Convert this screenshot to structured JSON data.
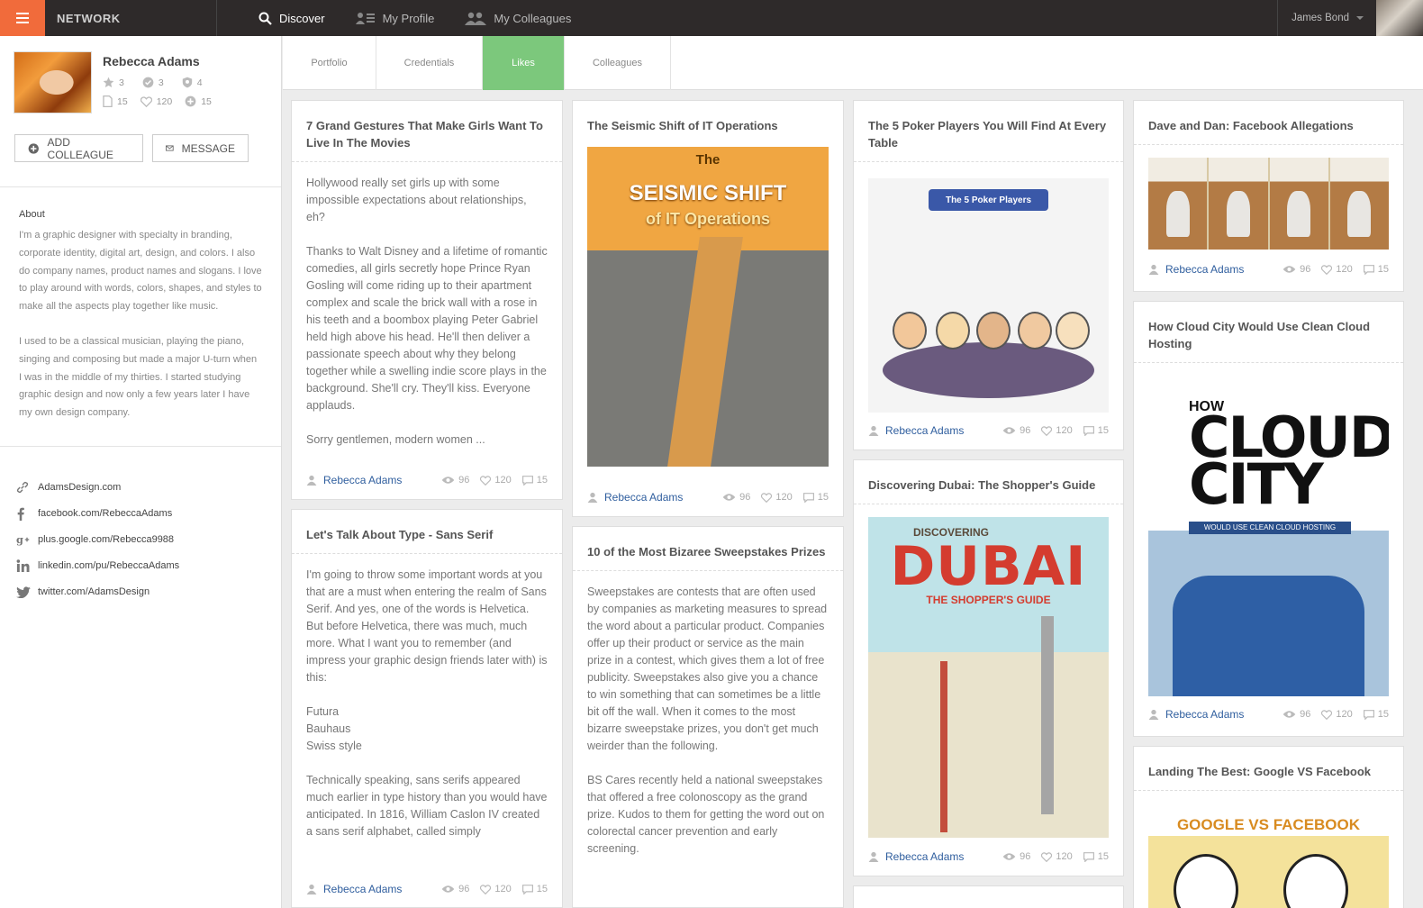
{
  "topbar": {
    "brand": "NETWORK",
    "nav": [
      {
        "label": "Discover",
        "icon": "search-icon"
      },
      {
        "label": "My Profile",
        "icon": "profile-icon"
      },
      {
        "label": "My Colleagues",
        "icon": "colleagues-icon"
      }
    ],
    "user_name": "James Bond"
  },
  "profile": {
    "name": "Rebecca Adams",
    "stats_row1": [
      "3",
      "3",
      "4"
    ],
    "stats_row2": [
      "15",
      "120",
      "15"
    ],
    "add_colleague": "ADD COLLEAGUE",
    "message": "MESSAGE",
    "about_title": "About",
    "about_p1": "I'm a graphic designer with specialty in branding, corporate identity, digital art, design, and colors. I also do company names, product names and slogans. I love to play around with words, colors, shapes, and styles to make all the aspects play together like music.",
    "about_p2": "I used to be a classical musician, playing the piano, singing and composing but made a major U-turn when I was in the middle of my thirties. I started studying graphic design and now only a few years later I have my own design company.",
    "links": [
      {
        "label": "AdamsDesign.com",
        "icon": "link-icon"
      },
      {
        "label": "facebook.com/RebeccaAdams",
        "icon": "facebook-icon"
      },
      {
        "label": "plus.google.com/Rebecca9988",
        "icon": "google-plus-icon"
      },
      {
        "label": "linkedin.com/pu/RebeccaAdams",
        "icon": "linkedin-icon"
      },
      {
        "label": "twitter.com/AdamsDesign",
        "icon": "twitter-icon"
      }
    ]
  },
  "tabs": [
    "Portfolio",
    "Credentials",
    "Likes",
    "Colleagues"
  ],
  "active_tab": "Likes",
  "card_meta": {
    "author": "Rebecca Adams",
    "views": "96",
    "likes": "120",
    "comments": "15"
  },
  "cards": {
    "c1": {
      "title": "7 Grand Gestures That Make Girls Want To Live In The Movies",
      "p1": "Hollywood really set girls up with some impossible expectations about relationships, eh?",
      "p2": "Thanks to Walt Disney and a lifetime of romantic comedies, all girls secretly hope Prince Ryan Gosling will come riding up to their apartment complex and scale the brick wall with a rose in his teeth and a boombox playing Peter Gabriel held high above his head. He'll then deliver a passionate speech about why they belong together while a swelling indie score plays in the background. She'll cry. They'll kiss. Everyone applauds.",
      "p3": "Sorry gentlemen, modern women ..."
    },
    "c2": {
      "title": "Let's Talk About Type - Sans Serif",
      "p1": "I'm going to throw some important words at you that are a must when entering the realm of Sans Serif. And yes, one of the words is Helvetica. But before Helvetica, there was much, much more. What I want you to remember (and impress your graphic design friends later with) is this:",
      "list": [
        "Futura",
        "Bauhaus",
        "Swiss style"
      ],
      "p2": "Technically speaking, sans serifs appeared much earlier in type history than you would have anticipated. In 1816, William Caslon IV created a sans serif alphabet, called simply"
    },
    "c3": {
      "title": "The Seismic Shift of IT Operations",
      "img_text": [
        "The",
        "SEISMIC SHIFT",
        "of IT Operations"
      ]
    },
    "c4": {
      "title": "10 of the Most Bizaree Sweepstakes Prizes",
      "p1": "Sweepstakes are contests that are often used by companies as marketing measures to spread the word about a particular product. Companies offer up their product or service as the main prize in a contest, which gives them a lot of free publicity. Sweepstakes also give you a chance to win something that can sometimes be a little bit off the wall. When it comes to the most bizarre sweepstake prizes, you don't get much weirder than the following.",
      "p2": "BS Cares recently held a national sweepstakes that offered a free colonoscopy as the grand prize. Kudos to them for getting the word out on colorectal cancer prevention and early screening."
    },
    "c5": {
      "title": "The 5 Poker Players You Will Find At Every Table",
      "img_text": "The 5 Poker Players"
    },
    "c6": {
      "title": "Discovering Dubai: The Shopper's Guide",
      "img_text": [
        "DISCOVERING",
        "DUBAI",
        "THE SHOPPER'S GUIDE"
      ]
    },
    "c7": {
      "title": "Dave and Dan: Facebook Allegations"
    },
    "c8": {
      "title": "How Cloud City Would Use Clean Cloud Hosting",
      "img_text": [
        "HOW",
        "CLOUD",
        "CITY",
        "WOULD USE CLEAN CLOUD HOSTING"
      ]
    },
    "c9": {
      "title": "Landing The Best: Google VS Facebook",
      "img_text": "GOOGLE VS FACEBOOK"
    }
  },
  "colors": {
    "accent": "#f16b3b",
    "tab_active": "#7cc87c",
    "topbar": "#2e2a2a",
    "link": "#2f5e9e"
  }
}
